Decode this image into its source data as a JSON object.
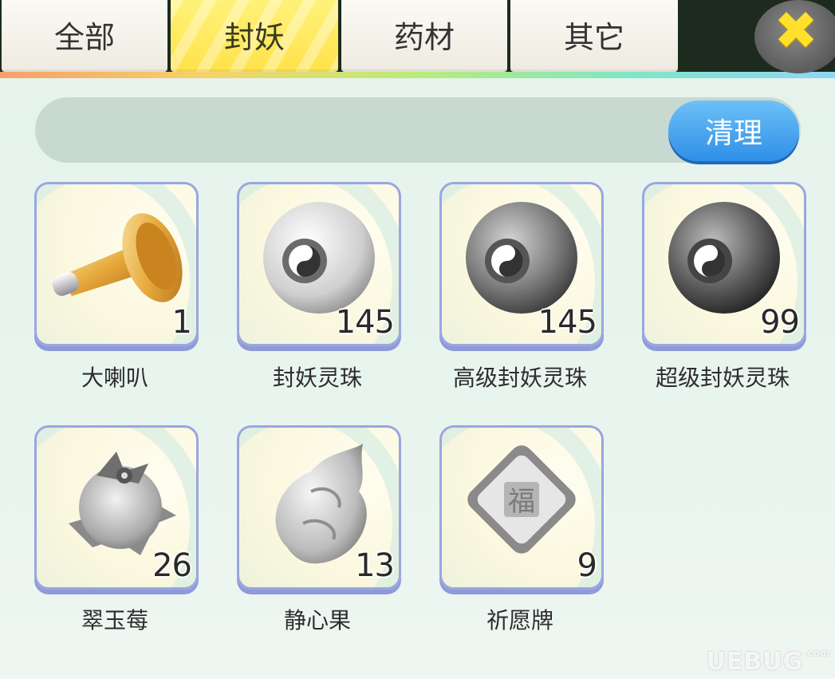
{
  "tabs": [
    {
      "label": "全部",
      "active": false
    },
    {
      "label": "封妖",
      "active": true
    },
    {
      "label": "药材",
      "active": false
    },
    {
      "label": "其它",
      "active": false
    }
  ],
  "close_icon": "close-x-icon",
  "toolbar": {
    "clean_label": "清理"
  },
  "items": [
    {
      "name": "大喇叭",
      "count": "1",
      "icon": "horn-icon"
    },
    {
      "name": "封妖灵珠",
      "count": "145",
      "icon": "white-orb-icon"
    },
    {
      "name": "高级封妖灵珠",
      "count": "145",
      "icon": "grey-orb-icon"
    },
    {
      "name": "超级封妖灵珠",
      "count": "99",
      "icon": "dark-orb-icon"
    },
    {
      "name": "翠玉莓",
      "count": "26",
      "icon": "berry-icon"
    },
    {
      "name": "静心果",
      "count": "13",
      "icon": "fruit-icon"
    },
    {
      "name": "祈愿牌",
      "count": "9",
      "icon": "prayer-tablet-icon"
    }
  ],
  "watermark": {
    "text": "UEBUG",
    "suffix": ".com"
  },
  "colors": {
    "active_tab": "#ffe24a",
    "button": "#2f8fe8",
    "card_border": "#9aa6e0"
  }
}
